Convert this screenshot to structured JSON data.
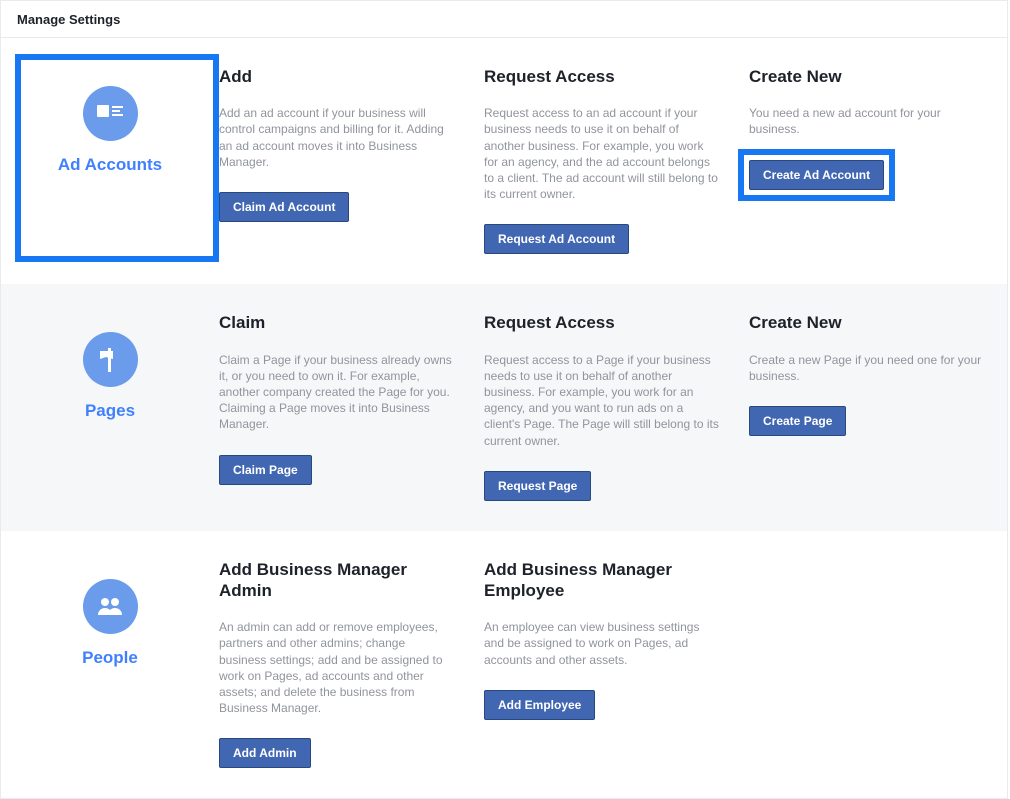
{
  "header": {
    "title": "Manage Settings"
  },
  "sections": {
    "adAccounts": {
      "label": "Ad Accounts",
      "add": {
        "title": "Add",
        "desc": "Add an ad account if your business will control campaigns and billing for it. Adding an ad account moves it into Business Manager.",
        "button": "Claim Ad Account"
      },
      "request": {
        "title": "Request Access",
        "desc": "Request access to an ad account if your business needs to use it on behalf of another business. For example, you work for an agency, and the ad account belongs to a client. The ad account will still belong to its current owner.",
        "button": "Request Ad Account"
      },
      "create": {
        "title": "Create New",
        "desc": "You need a new ad account for your business.",
        "button": "Create Ad Account"
      }
    },
    "pages": {
      "label": "Pages",
      "claim": {
        "title": "Claim",
        "desc": "Claim a Page if your business already owns it, or you need to own it. For example, another company created the Page for you. Claiming a Page moves it into Business Manager.",
        "button": "Claim Page"
      },
      "request": {
        "title": "Request Access",
        "desc": "Request access to a Page if your business needs to use it on behalf of another business. For example, you work for an agency, and you want to run ads on a client's Page. The Page will still belong to its current owner.",
        "button": "Request Page"
      },
      "create": {
        "title": "Create New",
        "desc": "Create a new Page if you need one for your business.",
        "button": "Create Page"
      }
    },
    "people": {
      "label": "People",
      "admin": {
        "title": "Add Business Manager Admin",
        "desc": "An admin can add or remove employees, partners and other admins; change business settings; add and be assigned to work on Pages, ad accounts and other assets; and delete the business from Business Manager.",
        "button": "Add Admin"
      },
      "employee": {
        "title": "Add Business Manager Employee",
        "desc": "An employee can view business settings and be assigned to work on Pages, ad accounts and other assets.",
        "button": "Add Employee"
      }
    }
  }
}
